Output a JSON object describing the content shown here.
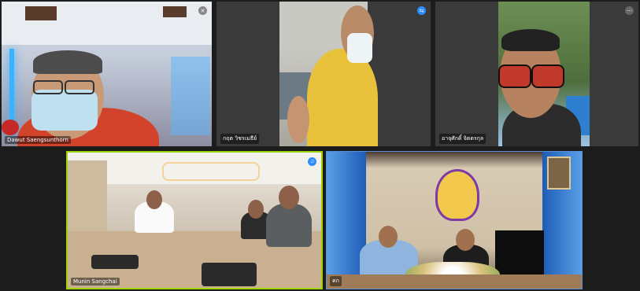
{
  "tiles": [
    {
      "id": "t1",
      "name": "Dawut Saengsunthorn",
      "badge_icon": "mic-muted-icon"
    },
    {
      "id": "t2",
      "name": "กฤต วิชรเมธีย์"
    },
    {
      "id": "t3",
      "name": "อาจุศักดิ์ จิตตรกุล",
      "badge_icon": "more-icon"
    },
    {
      "id": "t4",
      "name": "Munin Sangchai",
      "badge_icon": "audio-icon"
    },
    {
      "id": "t5",
      "name": "คก"
    }
  ],
  "colors": {
    "active_border": "#9fd400",
    "badge_blue": "#2d8cff"
  }
}
